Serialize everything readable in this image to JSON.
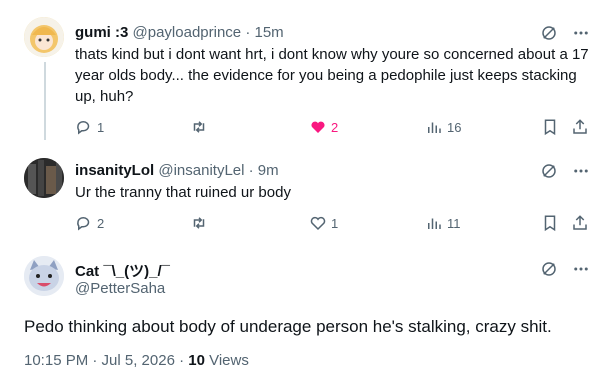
{
  "replies": [
    {
      "name": "gumi :3",
      "handle": "@payloadprince",
      "time": "· 15m",
      "text": "thats kind but i dont want hrt, i dont know why youre so concerned about a 17 year olds body... the evidence for you being a pedophile just keeps stacking up, huh?",
      "replies": "1",
      "reposts": "",
      "likes": "2",
      "liked": true,
      "views": "16"
    },
    {
      "name": "insanityLol",
      "handle": "@insanityLel",
      "time": "· 9m",
      "text": "Ur the tranny that ruined ur body",
      "replies": "2",
      "reposts": "",
      "likes": "1",
      "liked": false,
      "views": "11"
    }
  ],
  "main_post": {
    "name": "Cat ¯\\_(ツ)_/¯",
    "handle": "@PetterSaha",
    "text": "Pedo thinking about body of underage person he's stalking, crazy shit.",
    "timestamp": "10:15 PM · Jul 5, 2026 · ",
    "views_count": "10",
    "views_label": " Views"
  },
  "colors": {
    "like_active": "#f91880",
    "muted": "#536471",
    "text": "#0f1419"
  },
  "icons": [
    "grok-icon",
    "more-icon",
    "reply-icon",
    "repost-icon",
    "like-icon",
    "views-icon",
    "bookmark-icon",
    "share-icon"
  ]
}
